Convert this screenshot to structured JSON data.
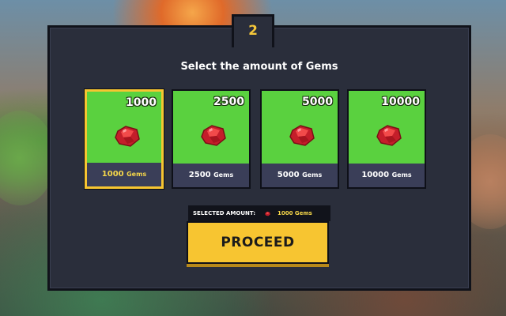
{
  "step": "2",
  "title": "Select the amount of Gems",
  "cards": [
    {
      "amount": "1000",
      "label_num": "1000",
      "label_unit": "Gems",
      "selected": true
    },
    {
      "amount": "2500",
      "label_num": "2500",
      "label_unit": "Gems",
      "selected": false
    },
    {
      "amount": "5000",
      "label_num": "5000",
      "label_unit": "Gems",
      "selected": false
    },
    {
      "amount": "10000",
      "label_num": "10000",
      "label_unit": "Gems",
      "selected": false
    }
  ],
  "selected_bar": {
    "label": "SELECTED AMOUNT:",
    "value": "1000 Gems"
  },
  "proceed_label": "PROCEED",
  "colors": {
    "card_green": "#5ad13f",
    "accent_yellow": "#f7c531",
    "panel": "#2a2e3b",
    "gem_red": "#d92b2b"
  },
  "icons": {
    "gem": "red-gem-icon"
  }
}
